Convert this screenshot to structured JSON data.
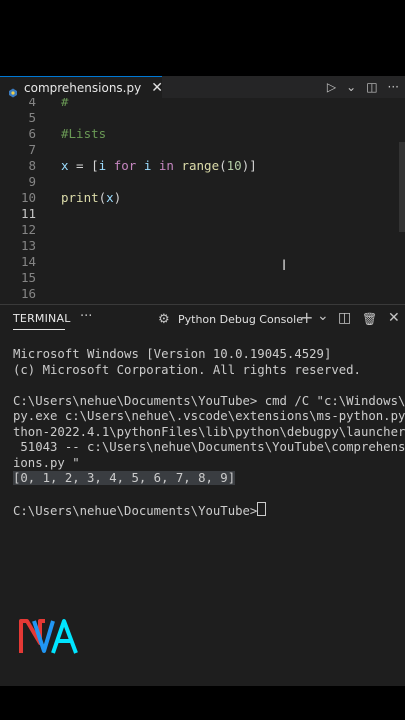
{
  "tab": {
    "label": "comprehensions.py",
    "close": "✕"
  },
  "editor_actions": {
    "run": "▷",
    "run_menu": "⌄",
    "split": "◫",
    "more": "···"
  },
  "code_lines": [
    {
      "num": "4",
      "tokens": [
        {
          "t": "#",
          "c": "comment"
        }
      ]
    },
    {
      "num": "5",
      "tokens": []
    },
    {
      "num": "6",
      "tokens": [
        {
          "t": "#Lists",
          "c": "comment"
        }
      ]
    },
    {
      "num": "7",
      "tokens": []
    },
    {
      "num": "8",
      "tokens": [
        {
          "t": "x",
          "c": "var"
        },
        {
          "t": " = [",
          "c": "plain"
        },
        {
          "t": "i",
          "c": "var"
        },
        {
          "t": " ",
          "c": "plain"
        },
        {
          "t": "for",
          "c": "kw"
        },
        {
          "t": " ",
          "c": "plain"
        },
        {
          "t": "i",
          "c": "var"
        },
        {
          "t": " ",
          "c": "plain"
        },
        {
          "t": "in",
          "c": "kw"
        },
        {
          "t": " ",
          "c": "plain"
        },
        {
          "t": "range",
          "c": "fn"
        },
        {
          "t": "(",
          "c": "plain"
        },
        {
          "t": "10",
          "c": "num"
        },
        {
          "t": ")]",
          "c": "plain"
        }
      ]
    },
    {
      "num": "9",
      "tokens": []
    },
    {
      "num": "10",
      "tokens": [
        {
          "t": "print",
          "c": "fn"
        },
        {
          "t": "(",
          "c": "plain"
        },
        {
          "t": "x",
          "c": "var"
        },
        {
          "t": ")",
          "c": "plain"
        }
      ]
    },
    {
      "num": "11",
      "active": true,
      "tokens": []
    },
    {
      "num": "12",
      "tokens": []
    },
    {
      "num": "13",
      "tokens": []
    },
    {
      "num": "14",
      "tokens": []
    },
    {
      "num": "15",
      "tokens": []
    },
    {
      "num": "16",
      "tokens": []
    }
  ],
  "panel": {
    "tab_label": "TERMINAL",
    "more": "···",
    "debug_icon": "⚙",
    "debug_label": "Python Debug Console",
    "add": "+",
    "add_menu": "⌄",
    "split": "◫",
    "trash": "🗑",
    "close": "✕"
  },
  "terminal_lines": [
    "Microsoft Windows [Version 10.0.19045.4529]",
    "(c) Microsoft Corporation. All rights reserved.",
    "",
    "C:\\Users\\nehue\\Documents\\YouTube> cmd /C \"c:\\Windows\\",
    "py.exe c:\\Users\\nehue\\.vscode\\extensions\\ms-python.py",
    "thon-2022.4.1\\pythonFiles\\lib\\python\\debugpy\\launcher",
    " 51043 -- c:\\Users\\nehue\\Documents\\YouTube\\comprehens",
    "ions.py \"",
    "[0, 1, 2, 3, 4, 5, 6, 7, 8, 9]",
    "",
    "C:\\Users\\nehue\\Documents\\YouTube>"
  ],
  "logo": {
    "text": "NVA",
    "colors": [
      "#e53935",
      "#2196f3",
      "#00e5ff"
    ]
  },
  "icons": {
    "python_file": "python-icon",
    "ibeam": "text-cursor-icon"
  }
}
